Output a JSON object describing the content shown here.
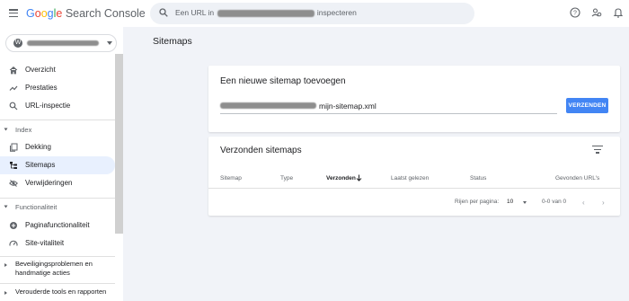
{
  "header": {
    "logo_google": "Google",
    "logo_product": "Search Console",
    "search_prefix": "Een URL in",
    "search_suffix": "inspecteren",
    "icons": [
      "menu-icon",
      "search-icon",
      "help-icon",
      "manage-users-icon",
      "notifications-icon"
    ]
  },
  "sidebar": {
    "property_icon": "W",
    "top_items": [
      {
        "label": "Overzicht",
        "icon": "home-icon"
      },
      {
        "label": "Prestaties",
        "icon": "trending-up-icon"
      },
      {
        "label": "URL-inspectie",
        "icon": "search-icon"
      }
    ],
    "index_section": "Index",
    "index_items": [
      {
        "label": "Dekking",
        "icon": "file-copy-icon"
      },
      {
        "label": "Sitemaps",
        "icon": "sitemap-icon",
        "active": true
      },
      {
        "label": "Verwijderingen",
        "icon": "visibility-off-icon"
      }
    ],
    "func_section": "Functionaliteit",
    "func_items": [
      {
        "label": "Paginafunctionaliteit",
        "icon": "add-circle-icon"
      },
      {
        "label": "Site-vitaliteit",
        "icon": "speed-icon"
      }
    ],
    "security": "Beveiligingsproblemen en handmatige acties",
    "legacy": "Verouderde tools en rapporten"
  },
  "main": {
    "page_title": "Sitemaps",
    "add_card": {
      "title": "Een nieuwe sitemap toevoegen",
      "input_value": "mijn-sitemap.xml",
      "submit_label": "VERZENDEN"
    },
    "submitted_card": {
      "title": "Verzonden sitemaps",
      "columns": {
        "sitemap": "Sitemap",
        "type": "Type",
        "submitted": "Verzonden",
        "last_read": "Laatst gelezen",
        "status": "Status",
        "urls": "Gevonden URL's"
      },
      "rows_per_page_label": "Rijen per pagina:",
      "rows_per_page": "10",
      "range": "0-0 van 0"
    }
  },
  "colors": {
    "accent": "#4285f4",
    "active_nav": "#e8f0fe",
    "main_bg": "#f1f3f8"
  }
}
